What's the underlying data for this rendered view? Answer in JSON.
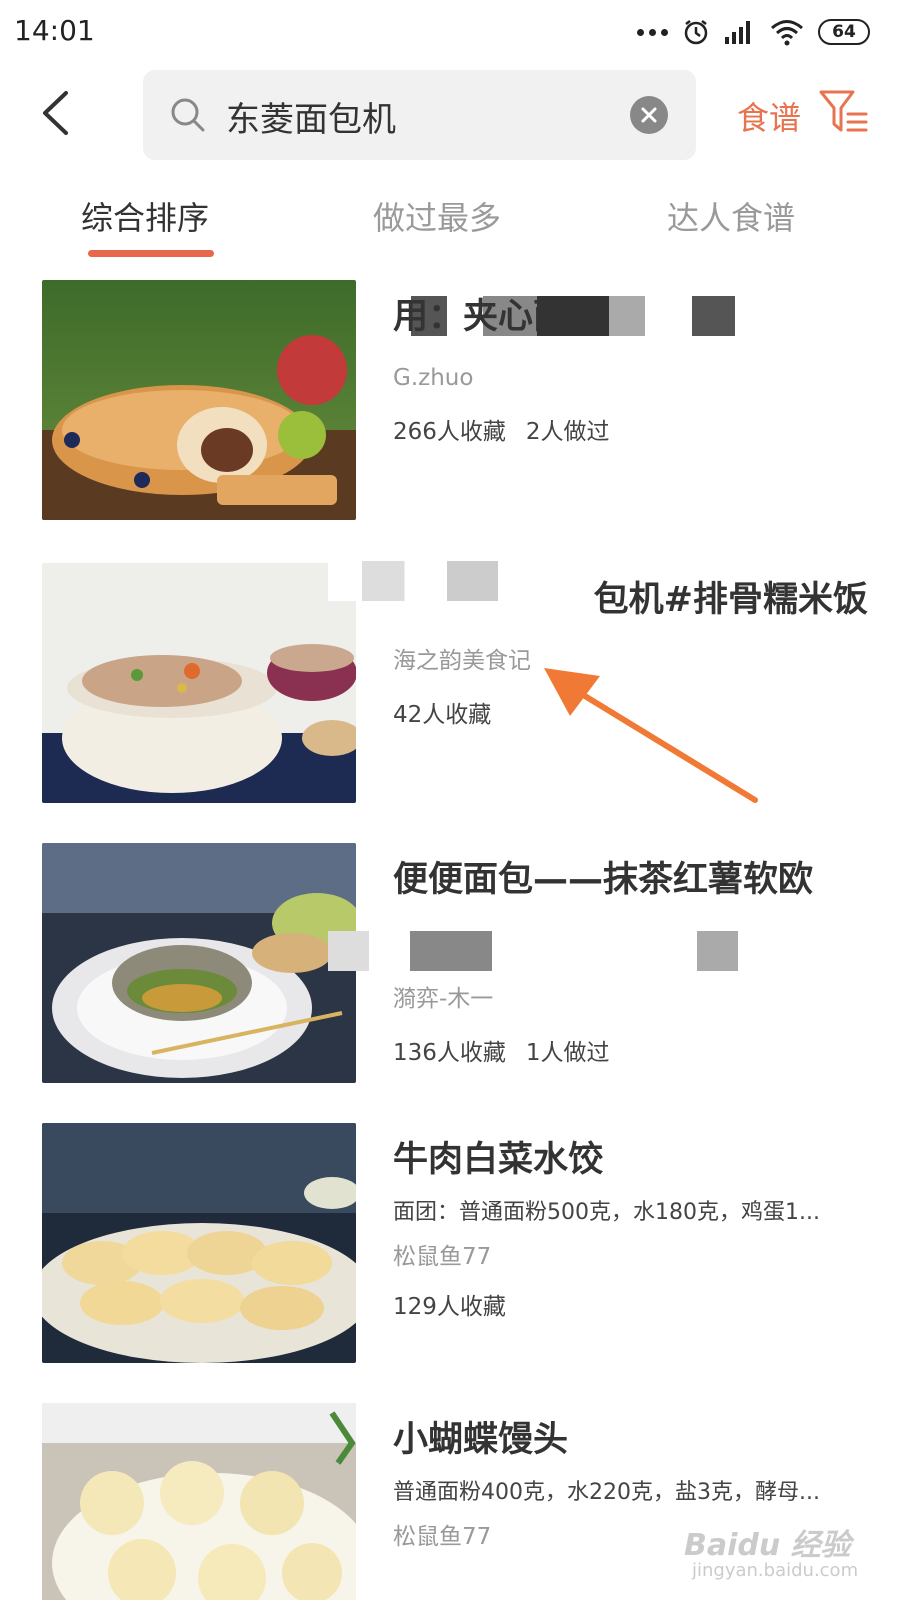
{
  "status_bar": {
    "time": "14:01",
    "battery": "64"
  },
  "header": {
    "back_icon": "chevron-left-icon",
    "search_query": "东菱面包机",
    "recipe_label": "食谱",
    "filter_icon": "filter-icon"
  },
  "tabs": [
    {
      "label": "综合排序",
      "active": true
    },
    {
      "label": "做过最多",
      "active": false
    },
    {
      "label": "达人食谱",
      "active": false
    }
  ],
  "recipes": [
    {
      "title": "用：夹心面包",
      "desc": "",
      "author": "G.zhuo",
      "favorites": "266人收藏",
      "made": "2人做过"
    },
    {
      "title": "包机#排骨糯米饭",
      "desc": "",
      "author": "海之韵美食记",
      "favorites": "42人收藏",
      "made": ""
    },
    {
      "title": "便便面包——抹茶红薯软欧",
      "desc": "",
      "author": "漪弈-木一",
      "favorites": "136人收藏",
      "made": "1人做过"
    },
    {
      "title": "牛肉白菜水饺",
      "desc": "面团：普通面粉500克，水180克，鸡蛋1...",
      "author": "松鼠鱼77",
      "favorites": "129人收藏",
      "made": ""
    },
    {
      "title": "小蝴蝶馒头",
      "desc": "普通面粉400克，水220克，盐3克，酵母...",
      "author": "松鼠鱼77",
      "favorites": "",
      "made": ""
    }
  ],
  "watermark": {
    "brand": "Baidu 经验",
    "url": "jingyan.baidu.com"
  },
  "colors": {
    "accent": "#e8734f",
    "tab_indicator": "#e8664c",
    "annotation_arrow": "#f07a35"
  }
}
